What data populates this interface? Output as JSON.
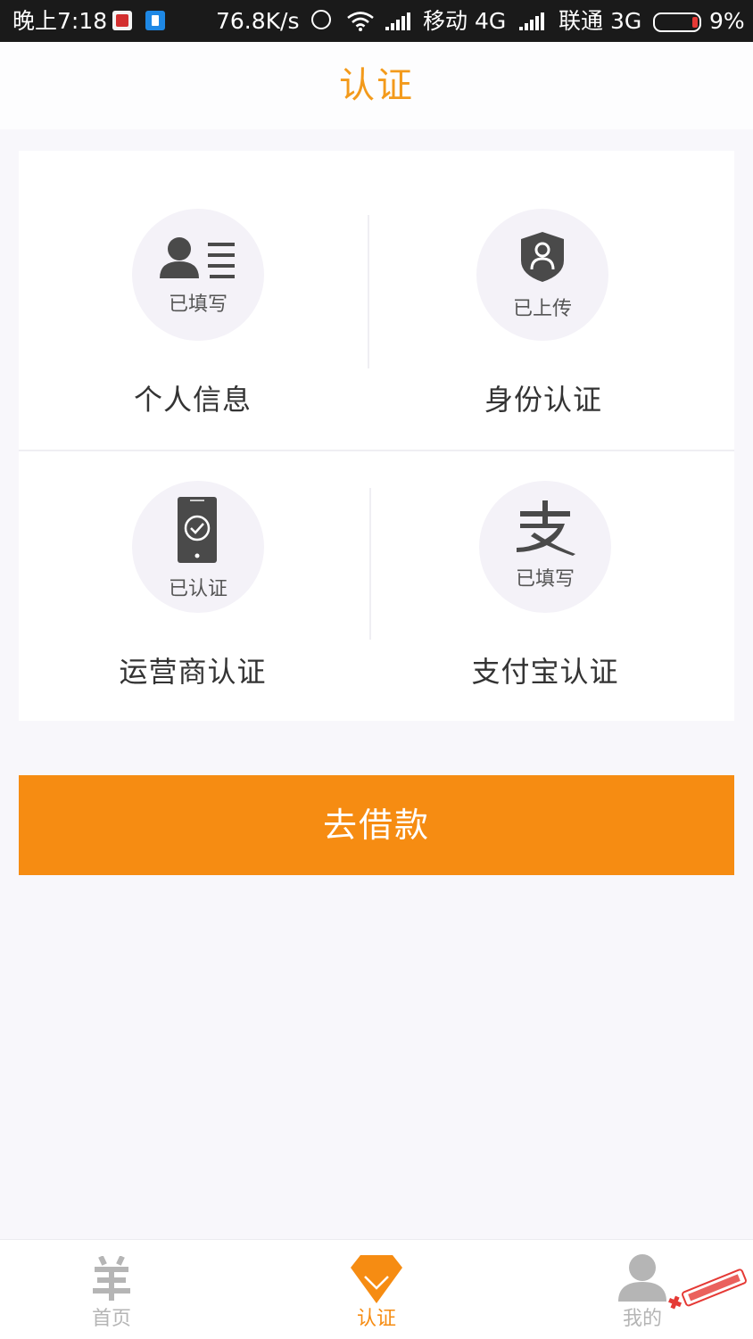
{
  "status_bar": {
    "time": "晚上7:18",
    "net_speed": "76.8K/s",
    "carrier1": "移动 4G",
    "carrier2": "联通 3G",
    "battery": "9%"
  },
  "header": {
    "title": "认证"
  },
  "cards": [
    {
      "label": "个人信息",
      "status": "已填写",
      "icon": "person-info-icon"
    },
    {
      "label": "身份认证",
      "status": "已上传",
      "icon": "id-shield-icon"
    },
    {
      "label": "运营商认证",
      "status": "已认证",
      "icon": "phone-check-icon"
    },
    {
      "label": "支付宝认证",
      "status": "已填写",
      "icon": "alipay-icon"
    }
  ],
  "borrow_button": {
    "label": "去借款"
  },
  "bottom_nav": {
    "items": [
      {
        "label": "首页",
        "icon": "sheep-icon",
        "active": false
      },
      {
        "label": "认证",
        "icon": "diamond-icon",
        "active": true
      },
      {
        "label": "我的",
        "icon": "user-icon",
        "active": false
      }
    ]
  },
  "colors": {
    "accent": "#f68c12",
    "title": "#f39a1b",
    "inactive_nav": "#b5b5b5",
    "icon_dark": "#4a4a4a"
  }
}
